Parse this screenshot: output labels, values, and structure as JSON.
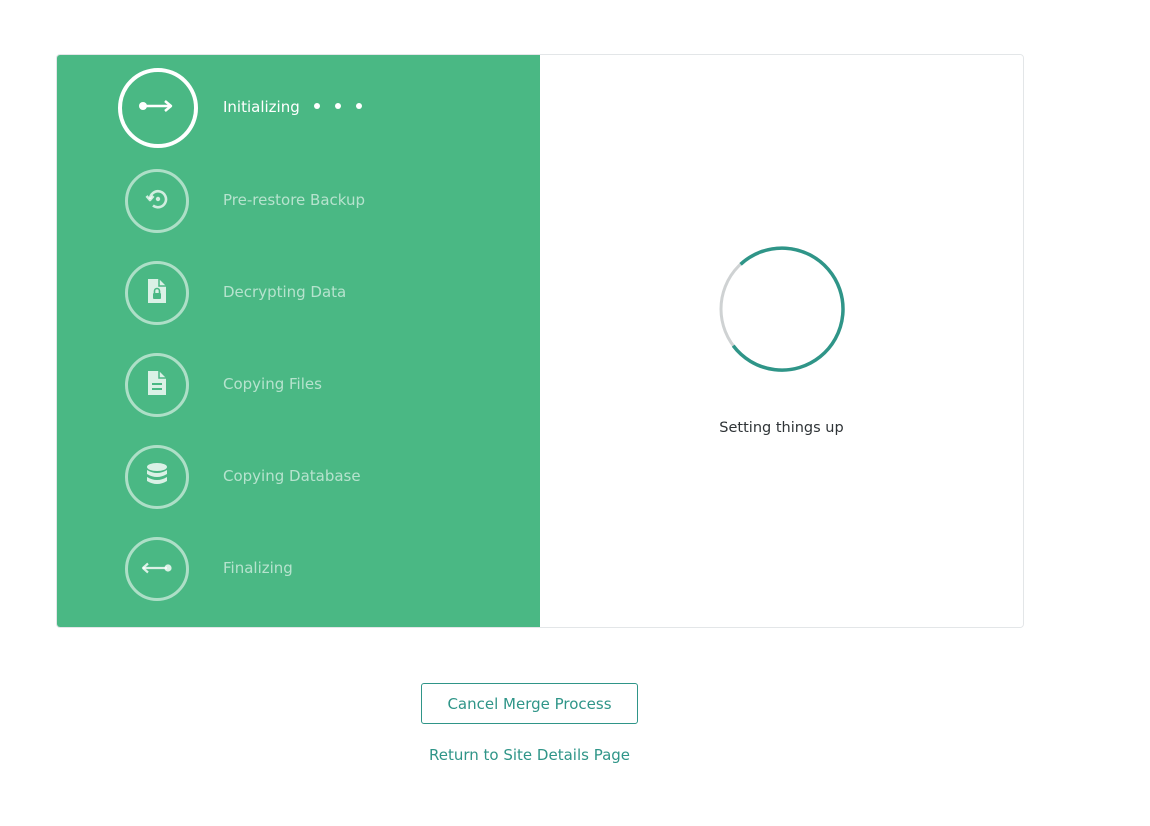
{
  "colors": {
    "panel_green": "#4ab884",
    "accent_teal": "#2f9588",
    "text_dark": "#2f3437"
  },
  "steps": [
    {
      "label": "Initializing",
      "icon": "arrow-right-icon",
      "state": "active"
    },
    {
      "label": "Pre-restore Backup",
      "icon": "restore-icon",
      "state": "pending"
    },
    {
      "label": "Decrypting Data",
      "icon": "locked-file-icon",
      "state": "pending"
    },
    {
      "label": "Copying Files",
      "icon": "file-icon",
      "state": "pending"
    },
    {
      "label": "Copying Database",
      "icon": "database-icon",
      "state": "pending"
    },
    {
      "label": "Finalizing",
      "icon": "arrow-left-icon",
      "state": "pending"
    }
  ],
  "status": {
    "text": "Setting things up"
  },
  "actions": {
    "cancel_label": "Cancel Merge Process",
    "return_label": "Return to Site Details Page"
  }
}
